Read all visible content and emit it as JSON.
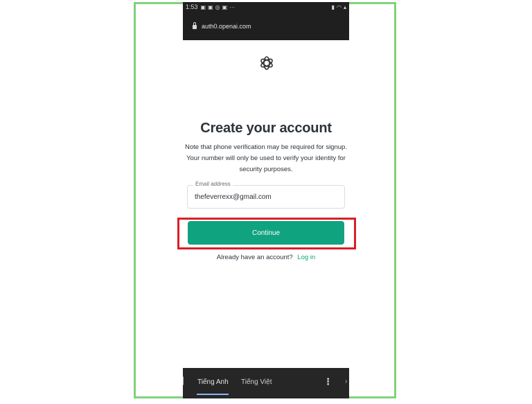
{
  "status_bar": {
    "time": "1:53",
    "icons_left": [
      "image-icon",
      "image-icon",
      "settings-icon",
      "image-icon"
    ],
    "more": "···",
    "icons_right": [
      "battery-icon",
      "wifi-icon",
      "signal-icon"
    ]
  },
  "browser": {
    "url": "auth0.openai.com"
  },
  "page": {
    "title": "Create your account",
    "note": "Note that phone verification may be required for signup. Your number will only be used to verify your identity for security purposes."
  },
  "form": {
    "email_label": "Email address",
    "email_value": "thefeverrexx@gmail.com",
    "continue_label": "Continue"
  },
  "login": {
    "prompt": "Already have an account?",
    "link_label": "Log in"
  },
  "translate_bar": {
    "tab_english": "Tiếng Anh",
    "tab_vietnamese": "Tiếng Việt",
    "menu_glyph": "⋮"
  },
  "colors": {
    "accent": "#10a37f",
    "highlight_frame": "#7fd27a",
    "annotation_box": "#d81f26",
    "title_text": "#2d333a"
  }
}
